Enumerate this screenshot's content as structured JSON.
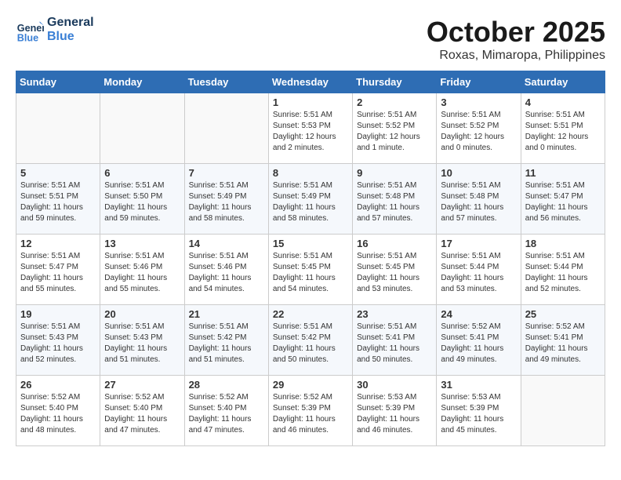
{
  "header": {
    "logo_line1": "General",
    "logo_line2": "Blue",
    "month": "October 2025",
    "location": "Roxas, Mimaropa, Philippines"
  },
  "weekdays": [
    "Sunday",
    "Monday",
    "Tuesday",
    "Wednesday",
    "Thursday",
    "Friday",
    "Saturday"
  ],
  "weeks": [
    [
      {
        "day": "",
        "info": ""
      },
      {
        "day": "",
        "info": ""
      },
      {
        "day": "",
        "info": ""
      },
      {
        "day": "1",
        "info": "Sunrise: 5:51 AM\nSunset: 5:53 PM\nDaylight: 12 hours and 2 minutes."
      },
      {
        "day": "2",
        "info": "Sunrise: 5:51 AM\nSunset: 5:52 PM\nDaylight: 12 hours and 1 minute."
      },
      {
        "day": "3",
        "info": "Sunrise: 5:51 AM\nSunset: 5:52 PM\nDaylight: 12 hours and 0 minutes."
      },
      {
        "day": "4",
        "info": "Sunrise: 5:51 AM\nSunset: 5:51 PM\nDaylight: 12 hours and 0 minutes."
      }
    ],
    [
      {
        "day": "5",
        "info": "Sunrise: 5:51 AM\nSunset: 5:51 PM\nDaylight: 11 hours and 59 minutes."
      },
      {
        "day": "6",
        "info": "Sunrise: 5:51 AM\nSunset: 5:50 PM\nDaylight: 11 hours and 59 minutes."
      },
      {
        "day": "7",
        "info": "Sunrise: 5:51 AM\nSunset: 5:49 PM\nDaylight: 11 hours and 58 minutes."
      },
      {
        "day": "8",
        "info": "Sunrise: 5:51 AM\nSunset: 5:49 PM\nDaylight: 11 hours and 58 minutes."
      },
      {
        "day": "9",
        "info": "Sunrise: 5:51 AM\nSunset: 5:48 PM\nDaylight: 11 hours and 57 minutes."
      },
      {
        "day": "10",
        "info": "Sunrise: 5:51 AM\nSunset: 5:48 PM\nDaylight: 11 hours and 57 minutes."
      },
      {
        "day": "11",
        "info": "Sunrise: 5:51 AM\nSunset: 5:47 PM\nDaylight: 11 hours and 56 minutes."
      }
    ],
    [
      {
        "day": "12",
        "info": "Sunrise: 5:51 AM\nSunset: 5:47 PM\nDaylight: 11 hours and 55 minutes."
      },
      {
        "day": "13",
        "info": "Sunrise: 5:51 AM\nSunset: 5:46 PM\nDaylight: 11 hours and 55 minutes."
      },
      {
        "day": "14",
        "info": "Sunrise: 5:51 AM\nSunset: 5:46 PM\nDaylight: 11 hours and 54 minutes."
      },
      {
        "day": "15",
        "info": "Sunrise: 5:51 AM\nSunset: 5:45 PM\nDaylight: 11 hours and 54 minutes."
      },
      {
        "day": "16",
        "info": "Sunrise: 5:51 AM\nSunset: 5:45 PM\nDaylight: 11 hours and 53 minutes."
      },
      {
        "day": "17",
        "info": "Sunrise: 5:51 AM\nSunset: 5:44 PM\nDaylight: 11 hours and 53 minutes."
      },
      {
        "day": "18",
        "info": "Sunrise: 5:51 AM\nSunset: 5:44 PM\nDaylight: 11 hours and 52 minutes."
      }
    ],
    [
      {
        "day": "19",
        "info": "Sunrise: 5:51 AM\nSunset: 5:43 PM\nDaylight: 11 hours and 52 minutes."
      },
      {
        "day": "20",
        "info": "Sunrise: 5:51 AM\nSunset: 5:43 PM\nDaylight: 11 hours and 51 minutes."
      },
      {
        "day": "21",
        "info": "Sunrise: 5:51 AM\nSunset: 5:42 PM\nDaylight: 11 hours and 51 minutes."
      },
      {
        "day": "22",
        "info": "Sunrise: 5:51 AM\nSunset: 5:42 PM\nDaylight: 11 hours and 50 minutes."
      },
      {
        "day": "23",
        "info": "Sunrise: 5:51 AM\nSunset: 5:41 PM\nDaylight: 11 hours and 50 minutes."
      },
      {
        "day": "24",
        "info": "Sunrise: 5:52 AM\nSunset: 5:41 PM\nDaylight: 11 hours and 49 minutes."
      },
      {
        "day": "25",
        "info": "Sunrise: 5:52 AM\nSunset: 5:41 PM\nDaylight: 11 hours and 49 minutes."
      }
    ],
    [
      {
        "day": "26",
        "info": "Sunrise: 5:52 AM\nSunset: 5:40 PM\nDaylight: 11 hours and 48 minutes."
      },
      {
        "day": "27",
        "info": "Sunrise: 5:52 AM\nSunset: 5:40 PM\nDaylight: 11 hours and 47 minutes."
      },
      {
        "day": "28",
        "info": "Sunrise: 5:52 AM\nSunset: 5:40 PM\nDaylight: 11 hours and 47 minutes."
      },
      {
        "day": "29",
        "info": "Sunrise: 5:52 AM\nSunset: 5:39 PM\nDaylight: 11 hours and 46 minutes."
      },
      {
        "day": "30",
        "info": "Sunrise: 5:53 AM\nSunset: 5:39 PM\nDaylight: 11 hours and 46 minutes."
      },
      {
        "day": "31",
        "info": "Sunrise: 5:53 AM\nSunset: 5:39 PM\nDaylight: 11 hours and 45 minutes."
      },
      {
        "day": "",
        "info": ""
      }
    ]
  ]
}
